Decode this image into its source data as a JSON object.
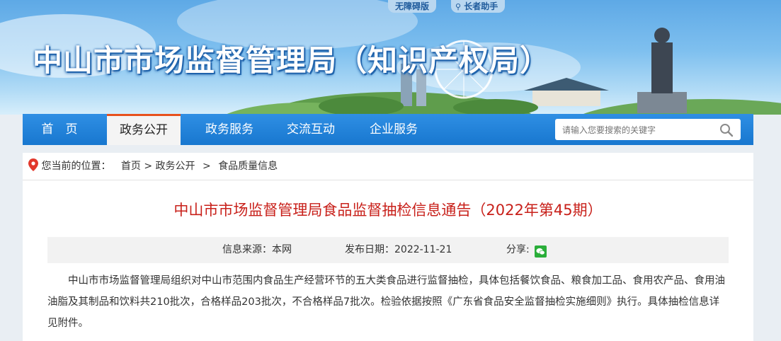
{
  "banner": {
    "title": "中山市市场监督管理局（知识产权局）",
    "accessibility_link": "无障碍版",
    "elder_link": "长者助手"
  },
  "nav": {
    "items": [
      {
        "label": "首　页"
      },
      {
        "label": "政务公开"
      },
      {
        "label": "政务服务"
      },
      {
        "label": "交流互动"
      },
      {
        "label": "企业服务"
      }
    ],
    "active_index": 1
  },
  "search": {
    "placeholder": "请输入您要搜索的关键字",
    "icon": "search-icon"
  },
  "breadcrumb": {
    "prefix": "您当前的位置：",
    "items": [
      "首页",
      "政务公开",
      "食品质量信息"
    ],
    "separator": ">"
  },
  "article": {
    "title": "中山市市场监督管理局食品监督抽检信息通告（2022年第45期）",
    "source": "信息来源：本网",
    "date": "发布日期：2022-11-21",
    "share_label": "分享:",
    "body": "中山市市场监督管理局组织对中山市范围内食品生产经营环节的五大类食品进行监督抽检，具体包括餐饮食品、粮食加工品、食用农产品、食用油油脂及其制品和饮料共210批次，合格样品203批次，不合格样品7批次。检验依据按照《广东省食品安全监督抽检实施细则》执行。具体抽检信息详见附件。"
  },
  "colors": {
    "nav_blue": "#1877cf",
    "title_red": "#c8201a",
    "active_tab_accent": "#e7511d",
    "wechat_green": "#2aae3a"
  }
}
